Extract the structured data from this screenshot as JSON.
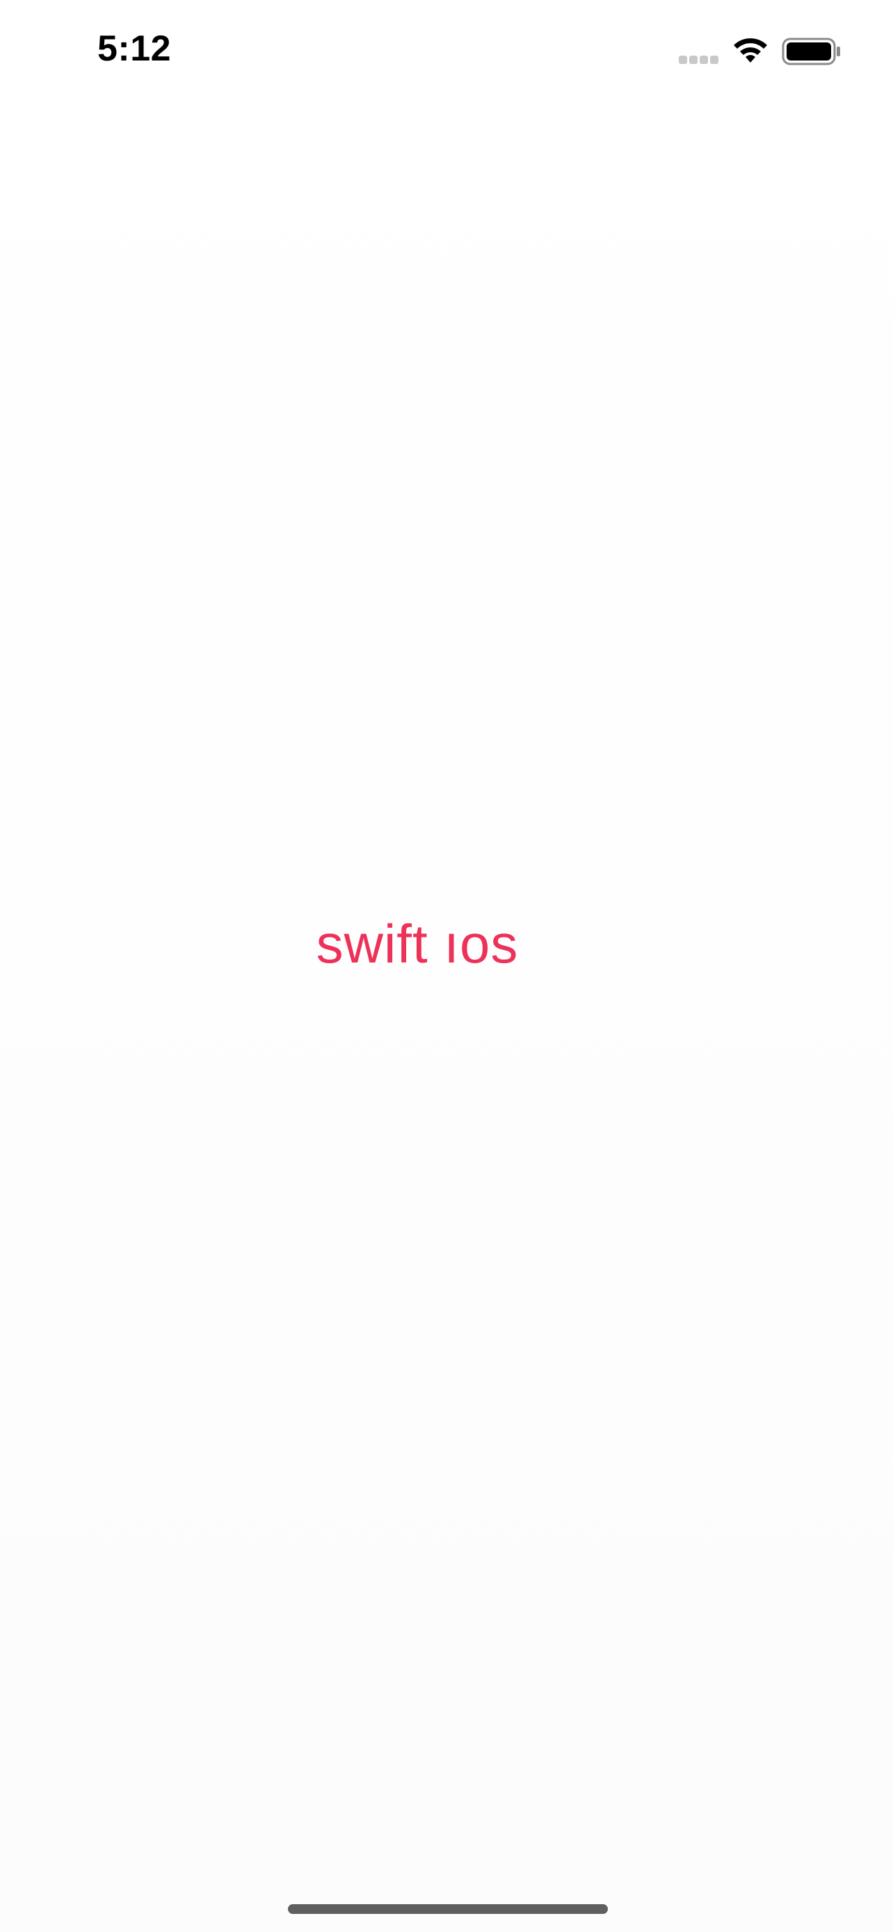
{
  "status_bar": {
    "time": "5:12",
    "signal_icon": "signal-dots-icon",
    "wifi_icon": "wifi-icon",
    "battery_icon": "battery-icon"
  },
  "main": {
    "label": "swift ıos",
    "label_color": "#ee3158"
  },
  "home_indicator_color": "#5f5f5f"
}
